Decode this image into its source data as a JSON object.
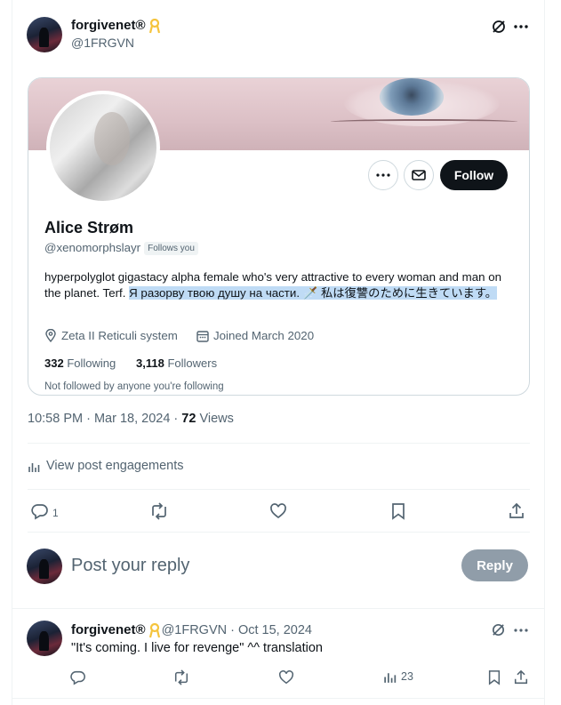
{
  "tweet": {
    "author_name": "forgivenet®",
    "author_handle": "@1FRGVN",
    "timestamp": "10:58 PM · Mar 18, 2024",
    "views_separator": " · ",
    "views_count": "72",
    "views_label": " Views",
    "engagements_label": "View post engagements",
    "reply_count": "1"
  },
  "profile_card": {
    "display_name": "Alice Strøm",
    "handle": "@xenomorphslayr",
    "follows_you": "Follows you",
    "bio_plain": "hyperpolyglot gigastacy alpha female who's very attractive to every woman and man on the planet. Terf. ",
    "bio_highlighted": "Я разорву твою душу на части. 🗡️ 私は復讐のために生きています。",
    "location": "Zeta II Reticuli system",
    "joined": "Joined March 2020",
    "following_count": "332",
    "following_label": "Following",
    "followers_count": "3,118",
    "followers_label": "Followers",
    "mutuals_note": "Not followed by anyone you're following",
    "follow_button": "Follow"
  },
  "composer": {
    "placeholder": "Post your reply",
    "reply_button": "Reply"
  },
  "reply": {
    "author_name": "forgivenet®",
    "author_handle": "@1FRGVN",
    "date": "· Oct 15, 2024",
    "text": "\"It's coming. I live for revenge\" ^^ translation",
    "views_count": "23"
  },
  "colors": {
    "accent_text": "#0f1419",
    "muted": "#536471",
    "highlight": "#bfdbf5",
    "ribbon": "#f5c43c"
  }
}
